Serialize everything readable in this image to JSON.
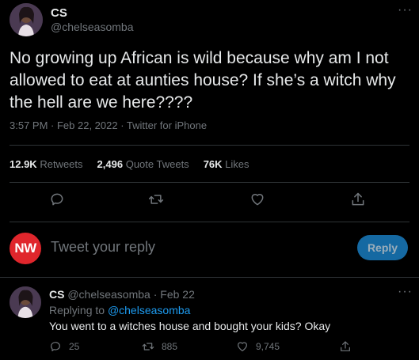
{
  "tweet": {
    "display_name": "CS",
    "handle": "@chelseasomba",
    "text": "No growing up African is wild because why am I not allowed to eat at aunties house? If she’s a witch why the hell are we here????",
    "timestamp": "3:57 PM · Feb 22, 2022 · Twitter for iPhone",
    "more_icon": "more-dots-icon"
  },
  "stats": {
    "retweets_count": "12.9K",
    "retweets_label": "Retweets",
    "quotes_count": "2,496",
    "quotes_label": "Quote Tweets",
    "likes_count": "76K",
    "likes_label": "Likes"
  },
  "composer": {
    "avatar_text": "NW",
    "placeholder": "Tweet your reply",
    "button_label": "Reply"
  },
  "reply": {
    "display_name": "CS",
    "handle_date": "@chelseasomba · Feb 22",
    "replying_to_prefix": "Replying to ",
    "replying_to_handle": "@chelseasomba",
    "text": "You went to a witches house and bought your kids? Okay",
    "reply_count": "25",
    "retweet_count": "885",
    "like_count": "9,745"
  },
  "colors": {
    "background": "#000000",
    "accent": "#1d9bf0",
    "brand_red": "#e0262c",
    "muted": "#71767b"
  }
}
